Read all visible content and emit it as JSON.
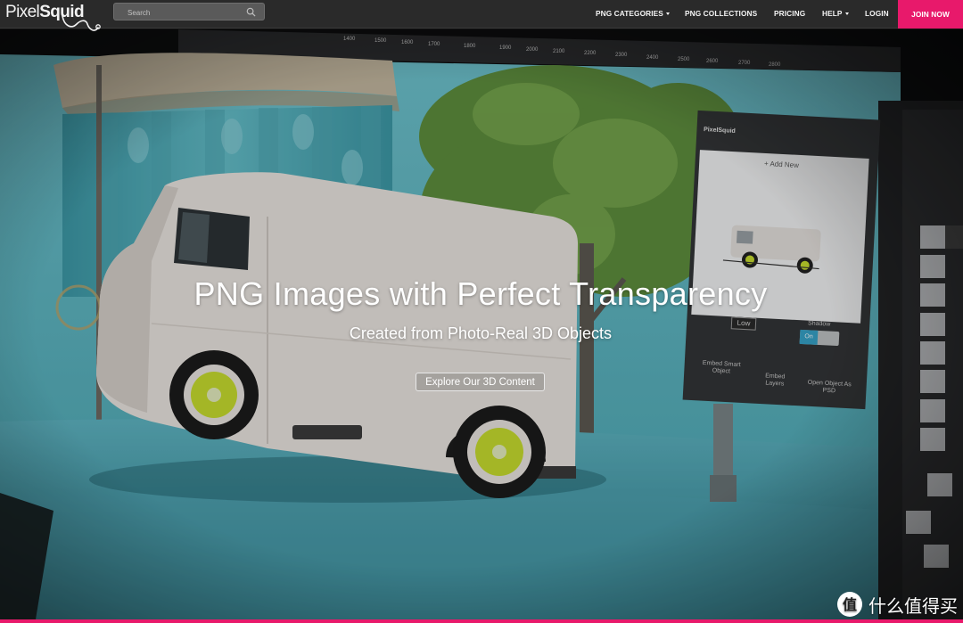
{
  "brand": {
    "logo_text_pixel": "Pixel",
    "logo_text_squid": "Squid",
    "accent_color": "#e8196b"
  },
  "search": {
    "placeholder": "Search",
    "icon": "search-icon"
  },
  "nav": {
    "items": [
      {
        "label": "PNG CATEGORIES",
        "has_dropdown": true
      },
      {
        "label": "PNG COLLECTIONS",
        "has_dropdown": false
      },
      {
        "label": "PRICING",
        "has_dropdown": false
      },
      {
        "label": "HELP",
        "has_dropdown": true
      },
      {
        "label": "LOGIN",
        "has_dropdown": false
      }
    ],
    "join_label": "JOIN NOW"
  },
  "hero": {
    "title": "PNG Images with Perfect Transparency",
    "subtitle": "Created from Photo-Real 3D Objects",
    "cta_label": "Explore Our 3D Content"
  },
  "screen_panel": {
    "title": "PixelSquid",
    "add_new": "+ Add New",
    "quality_value": "Low",
    "shadow_label": "Shadow",
    "toggle_value": "On",
    "actions": [
      {
        "label": "Embed Smart Object"
      },
      {
        "label": "Embed Layers"
      },
      {
        "label": "Open Object As PSD"
      }
    ]
  },
  "ruler_numbers": [
    "1400",
    "1500",
    "1600",
    "1700",
    "1800",
    "1900",
    "2000",
    "2100",
    "2200",
    "2300",
    "2400",
    "2500",
    "2600",
    "2700",
    "2800"
  ],
  "watermark": {
    "text": "什么值得买",
    "icon": "smzdm-logo-icon"
  }
}
